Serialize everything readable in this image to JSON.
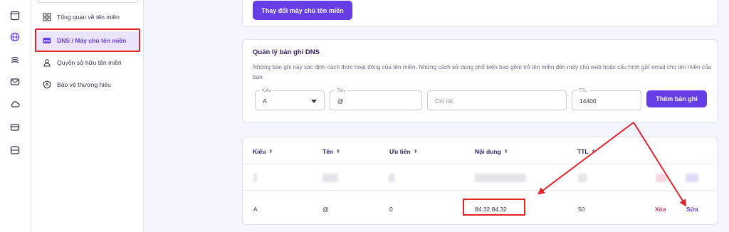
{
  "sidebar": {
    "items": [
      {
        "label": "Tổng quan về tên miền",
        "icon": "grid-icon"
      },
      {
        "label": "DNS / Máy chủ tên miền",
        "icon": "dns-icon"
      },
      {
        "label": "Quyền sở hữu tên miền",
        "icon": "user-icon"
      },
      {
        "label": "Bảo vệ thương hiệu",
        "icon": "shield-icon"
      }
    ]
  },
  "rail": {
    "icons": [
      "window-icon",
      "globe-icon",
      "layers-icon",
      "mail-icon",
      "cloud-icon",
      "card-icon",
      "server-icon"
    ]
  },
  "top_card": {
    "button_label": "Thay đổi máy chủ tên miền"
  },
  "dns_manager": {
    "title": "Quản lý bản ghi DNS",
    "description": "Những bản ghi này xác định cách thức hoạt động của tên miền. Những cách sử dụng phổ biến bao gồm trỏ tên miền đến máy chủ web hoặc cấu hình gửi email cho tên miền của bạn.",
    "form": {
      "type_label": "Kiểu",
      "type_value": "A",
      "name_label": "Tên",
      "name_value": "@",
      "target_placeholder": "Chỉ tới",
      "ttl_label": "TTL",
      "ttl_value": "14400",
      "add_button": "Thêm bản ghi"
    }
  },
  "records_table": {
    "columns": [
      "Kiểu",
      "Tên",
      "Ưu tiên",
      "Nội dung",
      "TTL"
    ],
    "rows": [
      {
        "type": "A",
        "name": "@",
        "priority": "0",
        "content": "84.32.84.32",
        "ttl": "50"
      }
    ],
    "delete_label": "Xóa",
    "edit_label": "Sửa"
  },
  "colors": {
    "accent": "#673de6",
    "highlight_red": "#e0242c",
    "delete_red": "#d63163",
    "text_dark": "#2f1c6a"
  }
}
